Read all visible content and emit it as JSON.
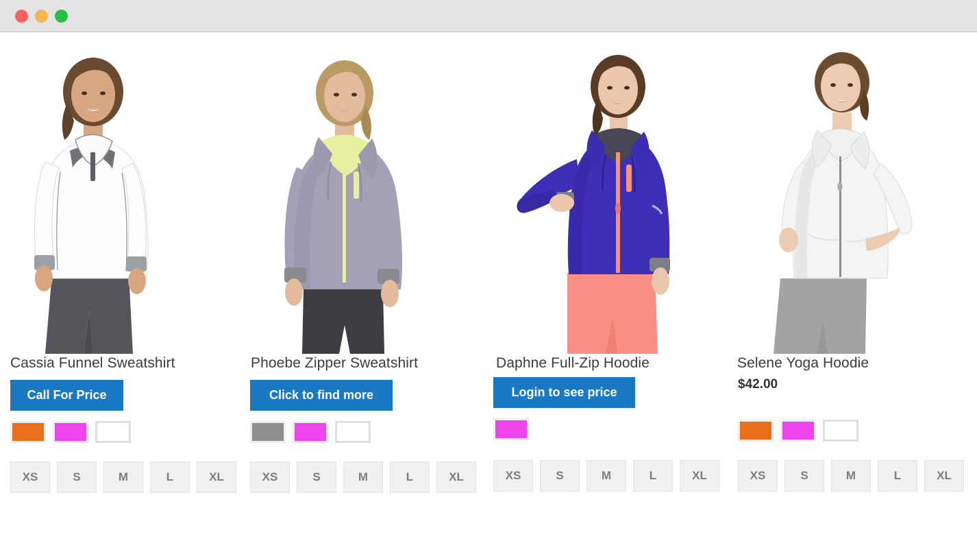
{
  "window": {
    "traffic_lights": [
      {
        "name": "close",
        "color": "#f9625e"
      },
      {
        "name": "minimize",
        "color": "#f9b44d"
      },
      {
        "name": "maximize",
        "color": "#25c141"
      }
    ]
  },
  "theme": {
    "cta_blue": "#1979c3",
    "swatch_orange": "#e8701a",
    "swatch_magenta": "#ee44f0",
    "swatch_gray": "#8f8f8f",
    "swatch_white": "#ffffff",
    "size_bg": "#f0f0f0",
    "size_text": "#7d7d7d",
    "title_text": "#3b3b3b"
  },
  "products": [
    {
      "name": "Cassia Funnel Sweatshirt",
      "cta_label": "Call For Price",
      "price": null,
      "garment_color": "#fdfdfd",
      "garment_shade": "#e8e8e8",
      "pants_color": "#54555a",
      "hair_color": "#6a4a30",
      "skin_color": "#d8a782",
      "accent_color": "#5d5f63",
      "swatches": [
        {
          "label": "orange",
          "color": "#e8701a"
        },
        {
          "label": "magenta",
          "color": "#ee44f0"
        },
        {
          "label": "white",
          "color": "#ffffff"
        }
      ],
      "sizes": [
        "XS",
        "S",
        "M",
        "L",
        "XL"
      ]
    },
    {
      "name": "Phoebe Zipper Sweatshirt",
      "cta_label": "Click to find more",
      "price": null,
      "garment_color": "#a5a0b6",
      "garment_shade": "#8e89a3",
      "pants_color": "#3e3e42",
      "hair_color": "#b99a63",
      "skin_color": "#e3bb9c",
      "accent_color": "#e7f0a0",
      "swatches": [
        {
          "label": "gray",
          "color": "#8f8f8f"
        },
        {
          "label": "magenta",
          "color": "#ee44f0"
        },
        {
          "label": "white",
          "color": "#ffffff"
        }
      ],
      "sizes": [
        "XS",
        "S",
        "M",
        "L",
        "XL"
      ]
    },
    {
      "name": "Daphne Full-Zip Hoodie",
      "cta_label": "Login to see price",
      "price": null,
      "garment_color": "#3d2fb8",
      "garment_shade": "#2f2396",
      "pants_color": "#f98e84",
      "hair_color": "#5a3c26",
      "skin_color": "#ecc6ab",
      "accent_color": "#fb9171",
      "swatches": [
        {
          "label": "magenta",
          "color": "#ee44f0"
        }
      ],
      "sizes": [
        "XS",
        "S",
        "M",
        "L",
        "XL"
      ]
    },
    {
      "name": "Selene Yoga Hoodie",
      "cta_label": null,
      "price": "$42.00",
      "garment_color": "#f4f4f4",
      "garment_shade": "#e0e0e0",
      "pants_color": "#a3a3a3",
      "hair_color": "#6d4b2e",
      "skin_color": "#eccbb0",
      "accent_color": "#8d8d8d",
      "swatches": [
        {
          "label": "orange",
          "color": "#e8701a"
        },
        {
          "label": "magenta",
          "color": "#ee44f0"
        },
        {
          "label": "white",
          "color": "#ffffff"
        }
      ],
      "sizes": [
        "XS",
        "S",
        "M",
        "L",
        "XL"
      ]
    }
  ]
}
